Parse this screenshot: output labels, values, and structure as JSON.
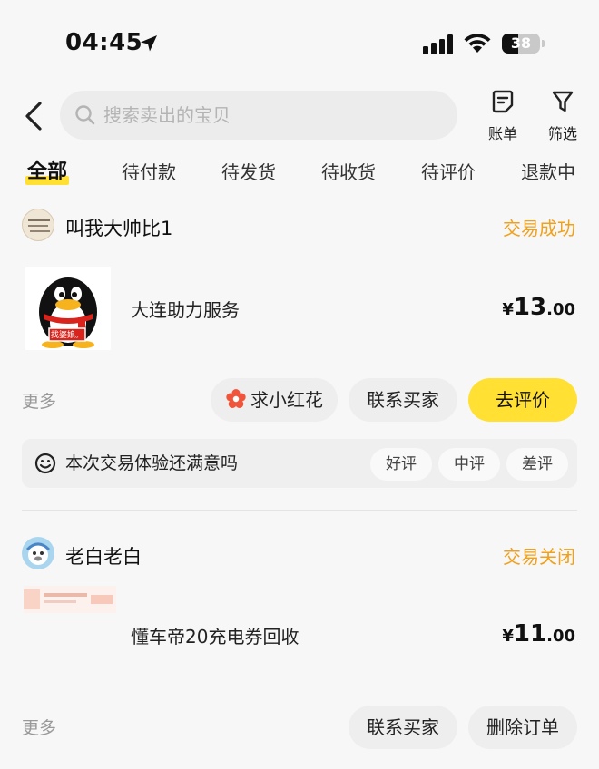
{
  "status_bar": {
    "time": "04:45",
    "battery": "38"
  },
  "search": {
    "placeholder": "搜索卖出的宝贝"
  },
  "header": {
    "bill_label": "账单",
    "filter_label": "筛选"
  },
  "tabs": [
    "全部",
    "待付款",
    "待发货",
    "待收货",
    "待评价",
    "退款中"
  ],
  "active_tab": "全部",
  "orders": [
    {
      "shop_name": "叫我大帅比1",
      "status": "交易成功",
      "item_title": "大连助力服务",
      "thumb_badge": "找婆娘。",
      "price_currency": "¥",
      "price_int": "13",
      "price_dec": ".00",
      "more_label": "更多",
      "actions": [
        "求小红花",
        "联系买家",
        "去评价"
      ],
      "rating_prompt": "本次交易体验还满意吗",
      "rating_options": [
        "好评",
        "中评",
        "差评"
      ]
    },
    {
      "shop_name": "老白老白",
      "status": "交易关闭",
      "item_title": "懂车帝20充电券回收",
      "price_currency": "¥",
      "price_int": "11",
      "price_dec": ".00",
      "more_label": "更多",
      "actions": [
        "联系买家",
        "删除订单"
      ]
    }
  ],
  "colors": {
    "accent": "#ffe033",
    "status": "#f0a11c",
    "flower": "#f0553c"
  }
}
